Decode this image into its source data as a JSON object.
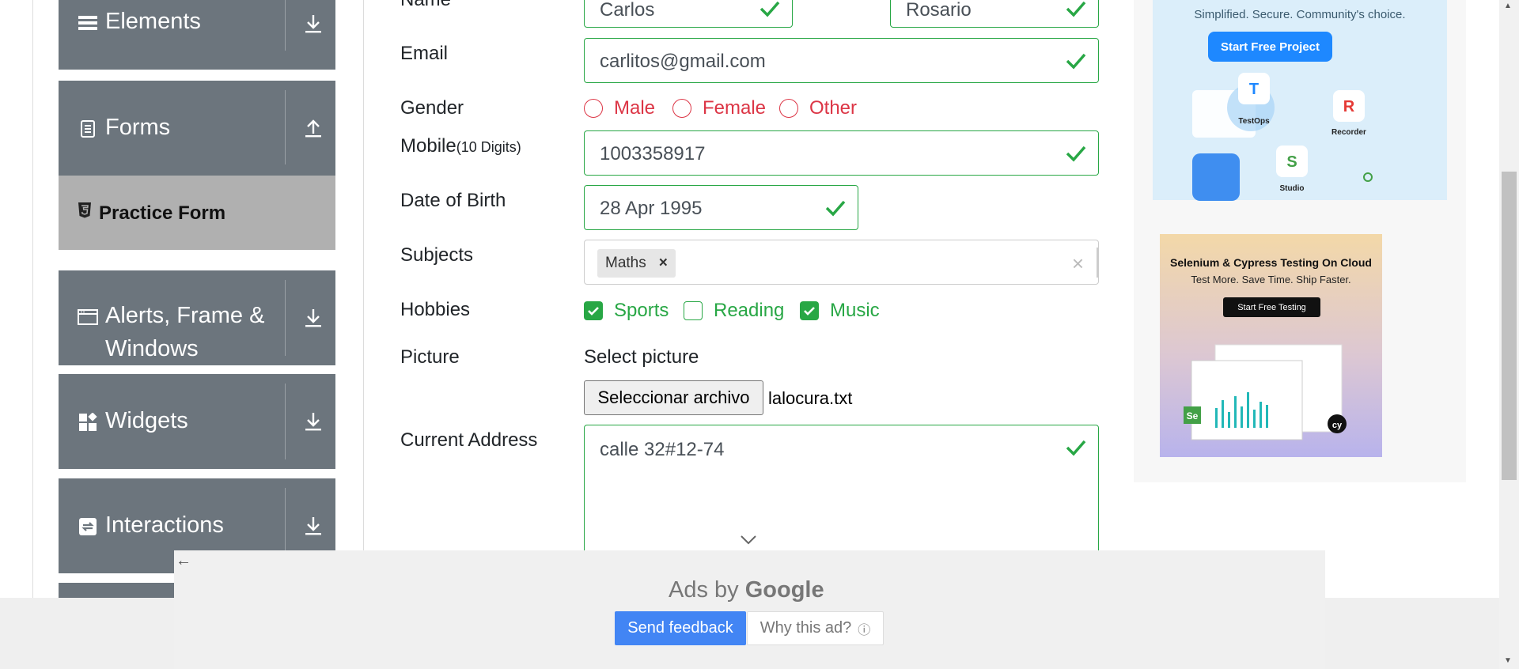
{
  "sidebar": {
    "groups": [
      {
        "label": "Elements"
      },
      {
        "label": "Forms"
      },
      {
        "label": "Alerts, Frame &",
        "label2": "Windows"
      },
      {
        "label": "Widgets"
      },
      {
        "label": "Interactions"
      }
    ],
    "active_item": "Practice Form"
  },
  "form": {
    "first_name": "Carlos",
    "last_name": "Rosario",
    "name_label": "Name",
    "email_label": "Email",
    "email_value": "carlitos@gmail.com",
    "gender_label": "Gender",
    "gender_options": [
      "Male",
      "Female",
      "Other"
    ],
    "mobile_label": "Mobile",
    "mobile_hint": "(10 Digits)",
    "mobile_value": "1003358917",
    "dob_label": "Date of Birth",
    "dob_value": "28 Apr 1995",
    "subjects_label": "Subjects",
    "subject_tags": [
      "Maths"
    ],
    "hobbies_label": "Hobbies",
    "hobbies": [
      {
        "label": "Sports",
        "checked": true
      },
      {
        "label": "Reading",
        "checked": false
      },
      {
        "label": "Music",
        "checked": true
      }
    ],
    "picture_label": "Picture",
    "select_picture": "Select picture",
    "file_button": "Seleccionar archivo",
    "file_name": "lalocura.txt",
    "address_label": "Current Address",
    "address_value": "calle 32#12-74"
  },
  "ad_katalon": {
    "tagline": "Simplified. Secure. Community's choice.",
    "cta": "Start Free Project",
    "labels": [
      "TestOps",
      "Recorder",
      "Studio"
    ]
  },
  "ad_testing": {
    "headline": "Selenium & Cypress Testing On Cloud",
    "sub": "Test More. Save Time. Ship Faster.",
    "cta": "Start Free Testing"
  },
  "ad_bar": {
    "ads_by": "Ads by",
    "google": "Google",
    "send_feedback": "Send feedback",
    "why": "Why this ad?"
  },
  "colors": {
    "valid": "#28a745",
    "invalid": "#dc3545",
    "sidebar": "#6c757d",
    "active": "#b0b0b0"
  }
}
